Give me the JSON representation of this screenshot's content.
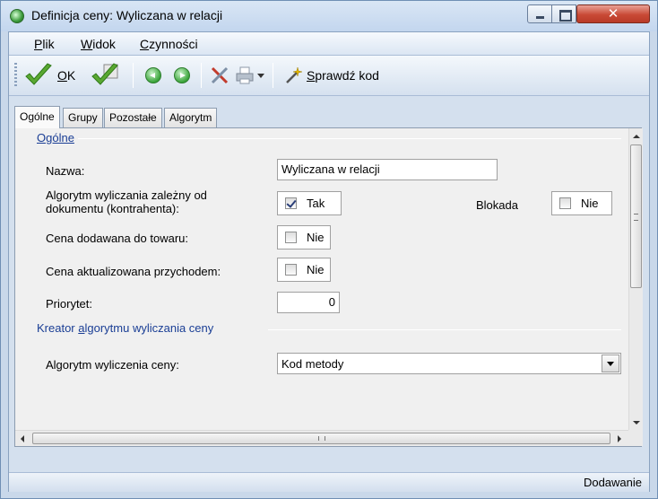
{
  "window": {
    "title": "Definicja ceny: Wyliczana w relacji"
  },
  "menu": {
    "items": [
      {
        "label": "Plik",
        "mnemonic": "P",
        "rest": "lik"
      },
      {
        "label": "Widok",
        "mnemonic": "W",
        "rest": "idok"
      },
      {
        "label": "Czynności",
        "mnemonic": "C",
        "rest": "zynności"
      }
    ]
  },
  "toolbar": {
    "ok_mnemonic": "O",
    "ok_rest": "K",
    "check_code_mnemonic": "S",
    "check_code_rest": "prawdź kod",
    "icons": [
      "ok-check-icon",
      "ok-save-check-icon",
      "back-arrow-icon",
      "forward-arrow-icon",
      "tools-icon",
      "print-icon",
      "dropdown-arrow-icon",
      "magic-wand-icon"
    ]
  },
  "tabs": [
    {
      "label": "Ogólne",
      "active": true
    },
    {
      "label": "Grupy",
      "active": false
    },
    {
      "label": "Pozostałe",
      "active": false
    },
    {
      "label": "Algorytm",
      "active": false
    }
  ],
  "general_group": {
    "title": "Ogólne",
    "name_label": "Nazwa:",
    "name_value": "Wyliczana w relacji",
    "algorithm_label_line1": "Algorytm wyliczania zależny od",
    "algorithm_label_line2": "dokumentu (kontrahenta):",
    "algorithm_checked": true,
    "algorithm_text": "Tak",
    "lock_label": "Blokada",
    "lock_checked": false,
    "lock_text": "Nie",
    "added_label": "Cena dodawana do towaru:",
    "added_checked": false,
    "added_text": "Nie",
    "updated_label": "Cena aktualizowana przychodem:",
    "updated_checked": false,
    "updated_text": "Nie",
    "priority_label": "Priorytet:",
    "priority_value": "0"
  },
  "creator_group": {
    "title_pre": "Kreator ",
    "title_mnemonic": "a",
    "title_rest": "lgorytmu wyliczania ceny",
    "method_label": "Algorytm wyliczenia ceny:",
    "method_value": "Kod metody"
  },
  "hscroll_center": "III",
  "status": {
    "text": "Dodawanie"
  },
  "colors": {
    "group_title": "#1a3e95",
    "ok_green": "#5aa832",
    "close_button": "#c94a36"
  }
}
